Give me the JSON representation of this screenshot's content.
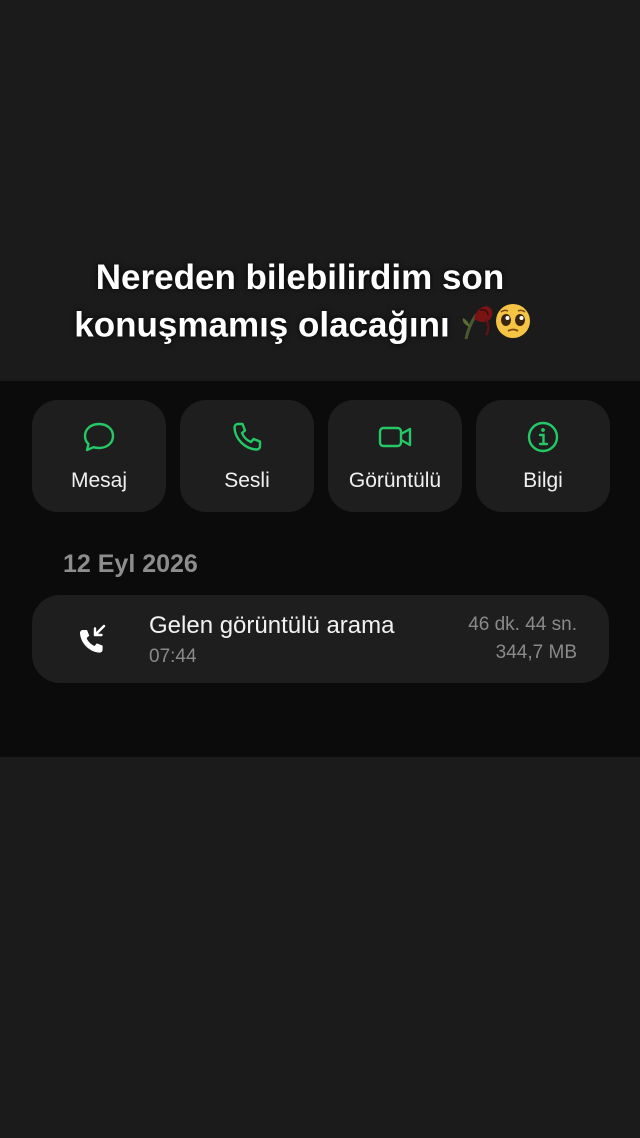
{
  "caption": {
    "line1": "Nereden bilebilirdim son",
    "line2": "konuşmamış olacağını",
    "emojis": [
      "wilted-rose-emoji",
      "pleading-face-emoji"
    ]
  },
  "actions": [
    {
      "label": "Mesaj",
      "icon": "message-bubble-icon"
    },
    {
      "label": "Sesli",
      "icon": "phone-icon"
    },
    {
      "label": "Görüntülü",
      "icon": "video-camera-icon"
    },
    {
      "label": "Bilgi",
      "icon": "info-icon"
    }
  ],
  "accent_color": "#25c866",
  "call_log": {
    "date": "12 Eyl 2026",
    "entries": [
      {
        "title": "Gelen görüntülü arama",
        "time": "07:44",
        "duration": "46 dk. 44 sn.",
        "size": "344,7 MB",
        "icon": "incoming-call-icon"
      }
    ]
  }
}
